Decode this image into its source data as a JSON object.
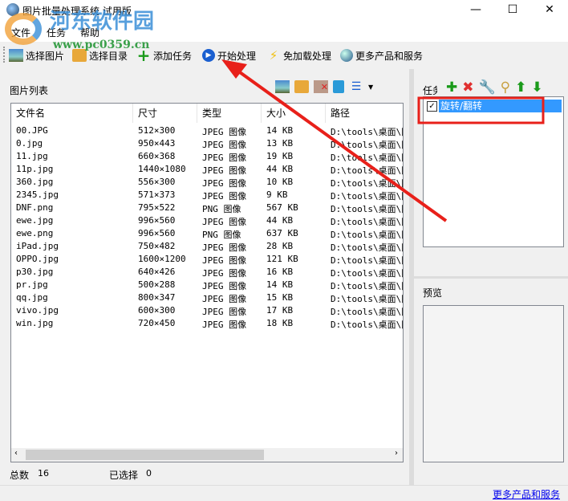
{
  "window": {
    "title": "图片批量处理系统 试用版",
    "minimize": "—",
    "maximize": "☐",
    "close": "✕"
  },
  "watermark": {
    "name": "河东软件园",
    "url": "www.pc0359.cn"
  },
  "menu": [
    "文件",
    "任务",
    "帮助"
  ],
  "toolbar": [
    {
      "label": "选择图片",
      "icon": "image-icon"
    },
    {
      "label": "选择目录",
      "icon": "folder-icon"
    },
    {
      "label": "添加任务",
      "icon": "plus-icon"
    },
    {
      "label": "开始处理",
      "icon": "play-icon"
    },
    {
      "label": "免加载处理",
      "icon": "lightning-icon"
    },
    {
      "label": "更多产品和服务",
      "icon": "globe-icon"
    }
  ],
  "list": {
    "title": "图片列表",
    "columns": [
      "文件名",
      "尺寸",
      "类型",
      "大小",
      "路径"
    ],
    "rows": [
      [
        "00.JPG",
        "512×300",
        "JPEG 图像",
        "14 KB",
        "D:\\tools\\桌面\\图"
      ],
      [
        "0.jpg",
        "950×443",
        "JPEG 图像",
        "13 KB",
        "D:\\tools\\桌面\\图"
      ],
      [
        "11.jpg",
        "660×368",
        "JPEG 图像",
        "19 KB",
        "D:\\tools\\桌面\\图"
      ],
      [
        "11p.jpg",
        "1440×1080",
        "JPEG 图像",
        "44 KB",
        "D:\\tools\\桌面\\图"
      ],
      [
        "360.jpg",
        "556×300",
        "JPEG 图像",
        "10 KB",
        "D:\\tools\\桌面\\图"
      ],
      [
        "2345.jpg",
        "571×373",
        "JPEG 图像",
        "9 KB",
        "D:\\tools\\桌面\\图"
      ],
      [
        "DNF.png",
        "795×522",
        "PNG 图像",
        "567 KB",
        "D:\\tools\\桌面\\图"
      ],
      [
        "ewe.jpg",
        "996×560",
        "JPEG 图像",
        "44 KB",
        "D:\\tools\\桌面\\图"
      ],
      [
        "ewe.png",
        "996×560",
        "PNG 图像",
        "637 KB",
        "D:\\tools\\桌面\\图"
      ],
      [
        "iPad.jpg",
        "750×482",
        "JPEG 图像",
        "28 KB",
        "D:\\tools\\桌面\\图"
      ],
      [
        "OPPO.jpg",
        "1600×1200",
        "JPEG 图像",
        "121 KB",
        "D:\\tools\\桌面\\图"
      ],
      [
        "p30.jpg",
        "640×426",
        "JPEG 图像",
        "16 KB",
        "D:\\tools\\桌面\\图"
      ],
      [
        "pr.jpg",
        "500×288",
        "JPEG 图像",
        "14 KB",
        "D:\\tools\\桌面\\图"
      ],
      [
        "qq.jpg",
        "800×347",
        "JPEG 图像",
        "15 KB",
        "D:\\tools\\桌面\\图"
      ],
      [
        "vivo.jpg",
        "600×300",
        "JPEG 图像",
        "17 KB",
        "D:\\tools\\桌面\\图"
      ],
      [
        "win.jpg",
        "720×450",
        "JPEG 图像",
        "18 KB",
        "D:\\tools\\桌面\\图"
      ]
    ]
  },
  "status": {
    "total_label": "总数",
    "total": "16",
    "selected_label": "已选择",
    "selected": "0"
  },
  "tasks": {
    "title": "任务",
    "items": [
      {
        "label": "旋转/翻转",
        "checked": true
      }
    ]
  },
  "preview": {
    "title": "预览"
  },
  "footer": {
    "link": "更多产品和服务"
  }
}
